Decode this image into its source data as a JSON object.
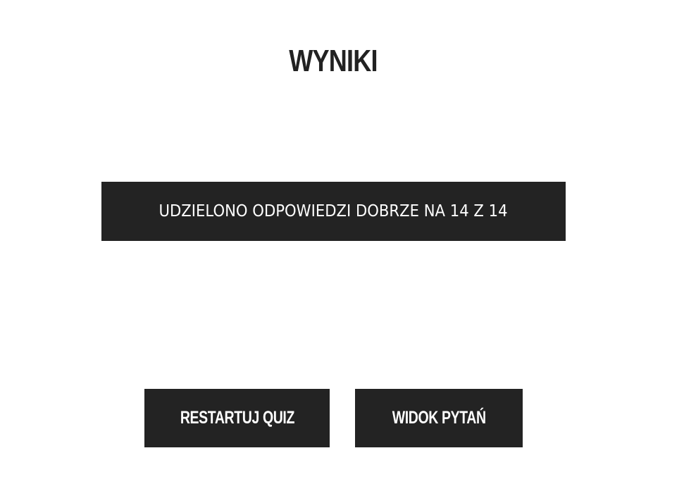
{
  "page": {
    "title": "WYNIKI"
  },
  "result": {
    "text": "UDZIELONO ODPOWIEDZI DOBRZE NA 14 Z 14",
    "correct": 14,
    "total": 14
  },
  "actions": {
    "restart_label": "RESTARTUJ QUIZ",
    "view_questions_label": "WIDOK PYTAŃ"
  },
  "colors": {
    "background": "#ffffff",
    "panel": "#232323",
    "text_dark": "#222222",
    "text_light": "#ffffff"
  }
}
